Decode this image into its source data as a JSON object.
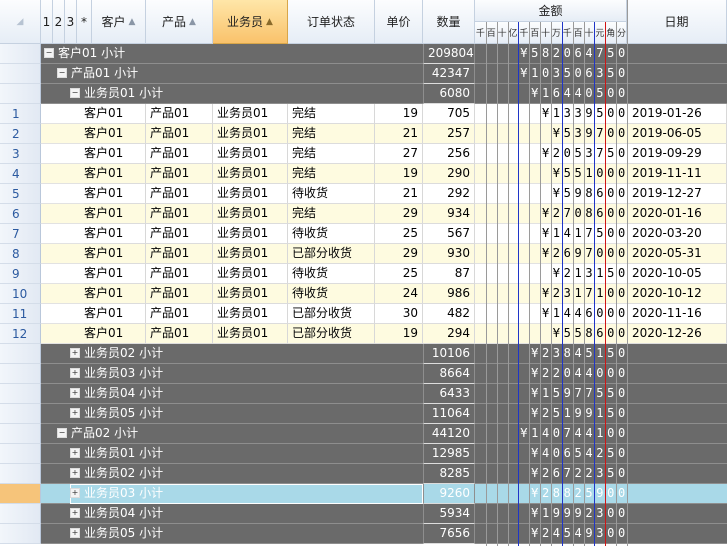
{
  "header": {
    "levels": [
      "1",
      "2",
      "3",
      "*"
    ],
    "columns": {
      "customer": "客户",
      "product": "产品",
      "salesperson": "业务员",
      "status": "订单状态",
      "price": "单价",
      "qty": "数量",
      "amount": "金额",
      "date": "日期"
    },
    "amount_digits": [
      "千",
      "百",
      "十",
      "亿",
      "千",
      "百",
      "十",
      "万",
      "千",
      "百",
      "十",
      "元",
      "角",
      "分"
    ]
  },
  "colors": {
    "group_bg": "#6a6a6a",
    "stripe": "#fefbe0",
    "selected_row": "#a9d9e8",
    "selected_header": "#f9c26b",
    "divider_blue": "#1f35c8",
    "divider_red": "#d01515"
  },
  "rows": [
    {
      "kind": "group",
      "level": 1,
      "toggle": "minus",
      "label": "客户01 小计",
      "qty": "209804",
      "amount": "¥58206475 0"
    },
    {
      "kind": "group",
      "level": 2,
      "toggle": "minus",
      "label": "产品01 小计",
      "qty": "42347",
      "amount": "¥10350635 0"
    },
    {
      "kind": "group",
      "level": 3,
      "toggle": "minus",
      "label": "业务员01 小计",
      "qty": "6080",
      "amount": "¥1644050 0"
    },
    {
      "kind": "data",
      "num": "1",
      "customer": "客户01",
      "product": "产品01",
      "salesperson": "业务员01",
      "status": "完结",
      "price": "19",
      "qty": "705",
      "amount": "¥133950 0",
      "date": "2019-01-26"
    },
    {
      "kind": "data",
      "num": "2",
      "customer": "客户01",
      "product": "产品01",
      "salesperson": "业务员01",
      "status": "完结",
      "price": "21",
      "qty": "257",
      "amount": "¥53970 0",
      "date": "2019-06-05"
    },
    {
      "kind": "data",
      "num": "3",
      "customer": "客户01",
      "product": "产品01",
      "salesperson": "业务员01",
      "status": "完结",
      "price": "27",
      "qty": "256",
      "amount": "¥205375 0",
      "date": "2019-09-29"
    },
    {
      "kind": "data",
      "num": "4",
      "customer": "客户01",
      "product": "产品01",
      "salesperson": "业务员01",
      "status": "完结",
      "price": "19",
      "qty": "290",
      "amount": "¥55100 0",
      "date": "2019-11-11"
    },
    {
      "kind": "data",
      "num": "5",
      "customer": "客户01",
      "product": "产品01",
      "salesperson": "业务员01",
      "status": "待收货",
      "price": "21",
      "qty": "292",
      "amount": "¥59860 0",
      "date": "2019-12-27"
    },
    {
      "kind": "data",
      "num": "6",
      "customer": "客户01",
      "product": "产品01",
      "salesperson": "业务员01",
      "status": "完结",
      "price": "29",
      "qty": "934",
      "amount": "¥270860 0",
      "date": "2020-01-16"
    },
    {
      "kind": "data",
      "num": "7",
      "customer": "客户01",
      "product": "产品01",
      "salesperson": "业务员01",
      "status": "待收货",
      "price": "25",
      "qty": "567",
      "amount": "¥141750 0",
      "date": "2020-03-20"
    },
    {
      "kind": "data",
      "num": "8",
      "customer": "客户01",
      "product": "产品01",
      "salesperson": "业务员01",
      "status": "已部分收货",
      "price": "29",
      "qty": "930",
      "amount": "¥269700 0",
      "date": "2020-05-31"
    },
    {
      "kind": "data",
      "num": "9",
      "customer": "客户01",
      "product": "产品01",
      "salesperson": "业务员01",
      "status": "待收货",
      "price": "25",
      "qty": "87",
      "amount": "¥21315 0",
      "date": "2020-10-05"
    },
    {
      "kind": "data",
      "num": "10",
      "customer": "客户01",
      "product": "产品01",
      "salesperson": "业务员01",
      "status": "待收货",
      "price": "24",
      "qty": "986",
      "amount": "¥231710 0",
      "date": "2020-10-12"
    },
    {
      "kind": "data",
      "num": "11",
      "customer": "客户01",
      "product": "产品01",
      "salesperson": "业务员01",
      "status": "已部分收货",
      "price": "30",
      "qty": "482",
      "amount": "¥144600 0",
      "date": "2020-11-16"
    },
    {
      "kind": "data",
      "num": "12",
      "customer": "客户01",
      "product": "产品01",
      "salesperson": "业务员01",
      "status": "已部分收货",
      "price": "19",
      "qty": "294",
      "amount": "¥55860 0",
      "date": "2020-12-26"
    },
    {
      "kind": "group",
      "level": 3,
      "toggle": "plus",
      "label": "业务员02 小计",
      "qty": "10106",
      "amount": "¥2384515 0"
    },
    {
      "kind": "group",
      "level": 3,
      "toggle": "plus",
      "label": "业务员03 小计",
      "qty": "8664",
      "amount": "¥2204400 0"
    },
    {
      "kind": "group",
      "level": 3,
      "toggle": "plus",
      "label": "业务员04 小计",
      "qty": "6433",
      "amount": "¥1597755 0"
    },
    {
      "kind": "group",
      "level": 3,
      "toggle": "plus",
      "label": "业务员05 小计",
      "qty": "11064",
      "amount": "¥2519915 0"
    },
    {
      "kind": "group",
      "level": 2,
      "toggle": "minus",
      "label": "产品02 小计",
      "qty": "44120",
      "amount": "¥14074410 0"
    },
    {
      "kind": "group",
      "level": 3,
      "toggle": "plus",
      "label": "业务员01 小计",
      "qty": "12985",
      "amount": "¥4065425 0"
    },
    {
      "kind": "group",
      "level": 3,
      "toggle": "plus",
      "label": "业务员02 小计",
      "qty": "8285",
      "amount": "¥2672235 0"
    },
    {
      "kind": "group",
      "level": 3,
      "toggle": "plus",
      "label": "业务员03 小计",
      "qty": "9260",
      "amount": "¥2882590 0",
      "selected": true
    },
    {
      "kind": "group",
      "level": 3,
      "toggle": "plus",
      "label": "业务员04 小计",
      "qty": "5934",
      "amount": "¥1999230 0"
    },
    {
      "kind": "group",
      "level": 3,
      "toggle": "plus",
      "label": "业务员05 小计",
      "qty": "7656",
      "amount": "¥2454930 0"
    }
  ]
}
